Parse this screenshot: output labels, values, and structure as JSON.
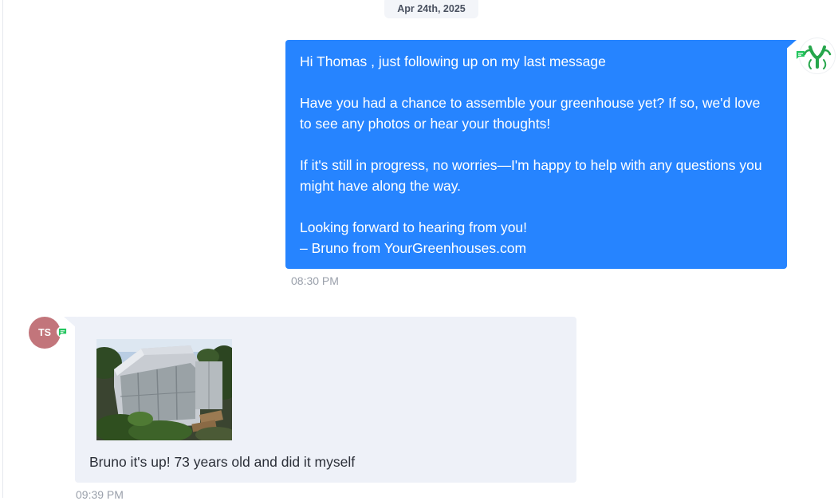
{
  "conversation": {
    "date_divider": "Apr 24th, 2025",
    "outgoing": {
      "lines": [
        "Hi Thomas , just following up on my last message",
        "Have you had a chance to assemble your greenhouse yet? If so, we'd love to see any photos or hear your thoughts!",
        "If it's still in progress, no worries—I'm happy to help with any questions you might have along the way.",
        "Looking forward to hearing from you!",
        "– Bruno from YourGreenhouses.com"
      ],
      "time": "08:30 PM",
      "avatar_icon": "yourgreenhouses-logo-icon",
      "channel_icon": "sms-channel-icon"
    },
    "incoming": {
      "avatar_initials": "TS",
      "avatar_color": "#c2757b",
      "channel_icon": "sms-channel-icon",
      "attachment_icon": "greenhouse-photo",
      "text": "Bruno it's up! 73 years old and did it myself",
      "time": "09:39 PM"
    }
  },
  "colors": {
    "outgoing_bubble": "#2684ff",
    "incoming_bubble": "#eef1f8",
    "channel_green": "#22c55e",
    "timestamp": "#9aa0ab"
  }
}
